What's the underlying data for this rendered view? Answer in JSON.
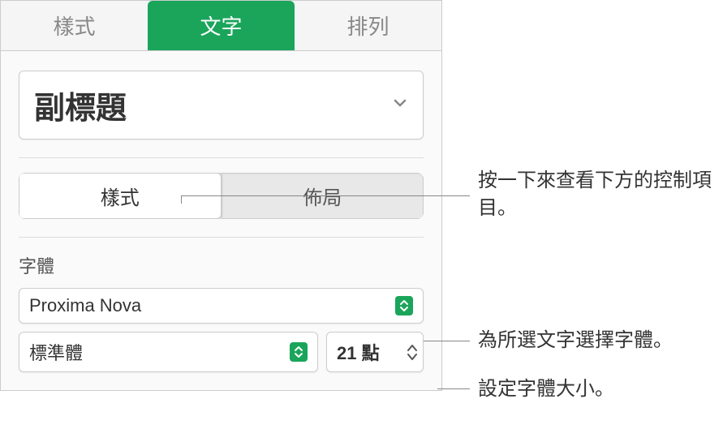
{
  "tabs": {
    "style": "樣式",
    "text": "文字",
    "arrange": "排列"
  },
  "paragraph_style": {
    "label": "副標題"
  },
  "segmented": {
    "style": "樣式",
    "layout": "佈局"
  },
  "font": {
    "section_label": "字體",
    "name": "Proxima Nova",
    "variant": "標準體",
    "size": "21",
    "size_unit": "點"
  },
  "callouts": {
    "segment": "按一下來查看下方的控制項目。",
    "font": "為所選文字選擇字體。",
    "size": "設定字體大小。"
  }
}
